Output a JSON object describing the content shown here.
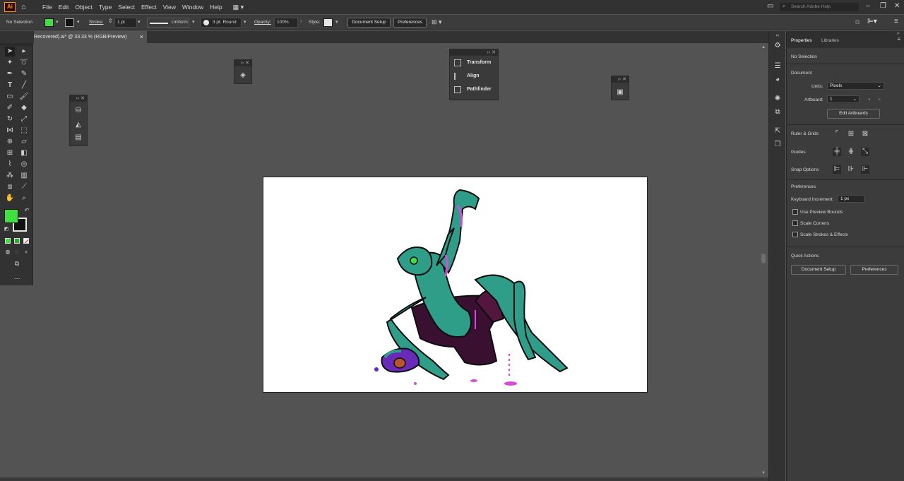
{
  "menubar": {
    "logo": "Ai",
    "items": [
      "File",
      "Edit",
      "Object",
      "Type",
      "Select",
      "Effect",
      "View",
      "Window",
      "Help"
    ],
    "search_placeholder": "Search Adobe Help"
  },
  "controlbar": {
    "selection": "No Selection",
    "stroke_label": "Stroke:",
    "stroke_weight": "1 pt",
    "stroke_profile": "Uniform",
    "brush": "3 pt. Round",
    "opacity_label": "Opacity:",
    "opacity_value": "100%",
    "style_label": "Style:",
    "document_setup": "Document Setup",
    "preferences": "Preferences",
    "fill_color": "#3ee13e"
  },
  "document": {
    "tab_title": "Recovered).ai* @ 33.33 % (RGB/Preview)",
    "close": "×"
  },
  "floating_panel": {
    "items": [
      "Transform",
      "Align",
      "Pathfinder"
    ]
  },
  "properties": {
    "tabs": [
      "Properties",
      "Libraries"
    ],
    "selection": "No Selection",
    "document_heading": "Document",
    "units_label": "Units:",
    "units_value": "Pixels",
    "artboard_label": "Artboard:",
    "artboard_value": "1",
    "edit_artboards": "Edit Artboards",
    "ruler_grids": "Ruler & Grids",
    "guides": "Guides",
    "snap_options": "Snap Options",
    "preferences_heading": "Preferences",
    "keyboard_increment_label": "Keyboard Increment:",
    "keyboard_increment_value": "1 px",
    "checkboxes": [
      "Use Preview Bounds",
      "Scale Corners",
      "Scale Strokes & Effects"
    ],
    "quick_actions": "Quick Actions",
    "document_setup": "Document Setup",
    "preferences_btn": "Preferences"
  },
  "colors": {
    "fill": "#3ee13e",
    "creature": "#2f9e88",
    "accent": "#d84bd8"
  }
}
